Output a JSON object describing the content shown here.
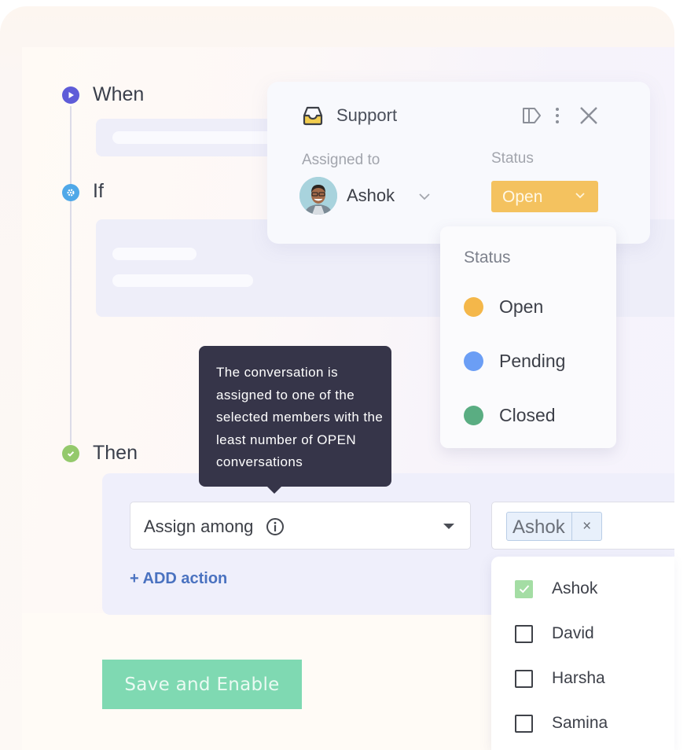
{
  "steps": [
    {
      "label": "When",
      "icon": "play-icon",
      "color": "#5e5cd8"
    },
    {
      "label": "If",
      "icon": "gear-icon",
      "color": "#4fa8e8"
    },
    {
      "label": "Then",
      "icon": "check-icon",
      "color": "#94c96c"
    }
  ],
  "support_card": {
    "title": "Support",
    "icons": [
      "inbox-icon",
      "label-tag-icon",
      "more-vertical-icon",
      "close-icon"
    ],
    "assigned_label": "Assigned to",
    "assignee": "Ashok",
    "status_label": "Status",
    "status_value": "Open",
    "status_color": "#f4c25f"
  },
  "status_menu": {
    "title": "Status",
    "options": [
      {
        "label": "Open",
        "color": "#f4b74a"
      },
      {
        "label": "Pending",
        "color": "#6b9ef5"
      },
      {
        "label": "Closed",
        "color": "#5aad82"
      }
    ]
  },
  "tooltip": {
    "text": "The conversation is assigned to one of the selected members with the least number of OPEN conversations"
  },
  "then_action": {
    "select_value": "Assign among",
    "add_action_label": "+ ADD action"
  },
  "members": {
    "selected_chip": "Ashok",
    "chip_remove": "×",
    "options": [
      {
        "label": "Ashok",
        "checked": true
      },
      {
        "label": "David",
        "checked": false
      },
      {
        "label": "Harsha",
        "checked": false
      },
      {
        "label": "Samina",
        "checked": false
      }
    ]
  },
  "save_button_label": "Save and Enable",
  "colors": {
    "accent_blue": "#4a72c0",
    "save_green": "#7fd9b2",
    "tooltip_bg": "#363549"
  }
}
